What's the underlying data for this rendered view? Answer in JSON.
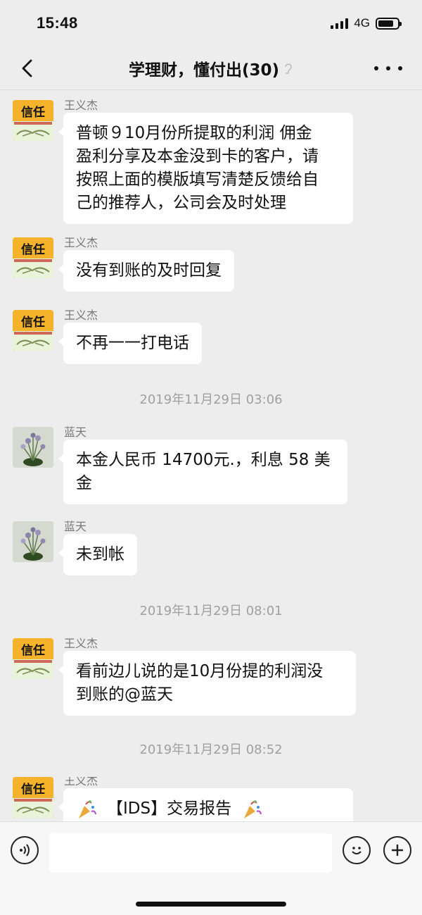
{
  "status_bar": {
    "time": "15:48",
    "network": "4G"
  },
  "header": {
    "title": "学理财，懂付出(30)"
  },
  "avatars": {
    "xinren": {
      "text": "信任"
    }
  },
  "messages": [
    {
      "sender": "王义杰",
      "text": "普顿９10月份所提取的利润 佣金\n盈利分享及本金没到卡的客户，请\n按照上面的模版填写清楚反馈给自\n己的推荐人，公司会及时处理"
    },
    {
      "sender": "王义杰",
      "text": "没有到账的及时回复"
    },
    {
      "sender": "王义杰",
      "text": "不再一一打电话"
    },
    {
      "sender": "蓝天",
      "text": "本金人民币 14700元.，利息 58 美\n金"
    },
    {
      "sender": "蓝天",
      "text": "未到帐"
    },
    {
      "sender": "王义杰",
      "text": "看前边儿说的是10月份提的利润没\n到账的@蓝天"
    },
    {
      "sender": "王义杰",
      "text": "【IDS】交易报告"
    }
  ],
  "timestamps": [
    "2019年11月29日 03:06",
    "2019年11月29日 08:01",
    "2019年11月29日 08:52"
  ],
  "input": {
    "placeholder": ""
  }
}
